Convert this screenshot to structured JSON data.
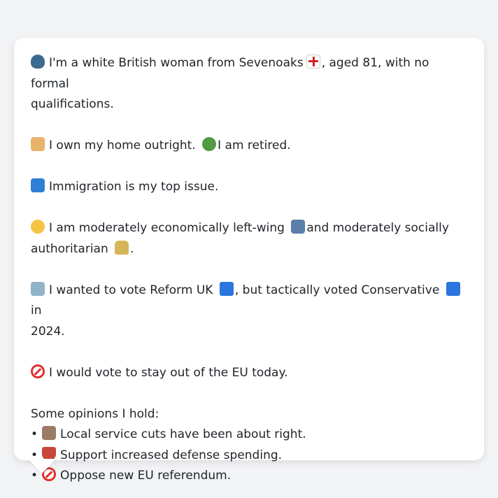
{
  "profile": {
    "intro_a": "I'm a white British woman from Sevenoaks",
    "intro_b": ", aged 81, with no formal",
    "intro_c": "qualifications.",
    "home_a": "I own my home outright.",
    "home_b": "I am retired.",
    "issue": "Immigration is my top issue.",
    "ideology_a": "I am moderately economically left-wing",
    "ideology_b": "and moderately socially",
    "ideology_c": "authoritarian",
    "ideology_d": ".",
    "vote_a": "I wanted to vote Reform UK",
    "vote_b": ", but tactically voted Conservative",
    "vote_c": "in",
    "vote_d": "2024.",
    "eu": "I would vote to stay out of the EU today.",
    "opinions_heading": "Some opinions I hold:",
    "bullet_char": "•",
    "opinions": [
      "Local service cuts have been about right.",
      "Support increased defense spending.",
      "Oppose new EU referendum."
    ]
  },
  "icons": {
    "person": "bust-in-silhouette-icon",
    "flag": "england-flag-icon",
    "house": "house-icon",
    "palm": "palm-tree-icon",
    "passport": "passport-control-icon",
    "think": "thinking-face-icon",
    "arrow": "left-arrow-icon",
    "lock": "lock-icon",
    "ballot": "ballot-box-icon",
    "blue_square": "blue-square-icon",
    "no_entry": "prohibited-icon",
    "derelict": "derelict-house-icon",
    "shield": "shield-icon"
  },
  "colors": {
    "background": "#f2f3f5",
    "card": "#ffffff",
    "text": "#1f2328",
    "party_blue": "#2a76de",
    "prohibited_red": "#e0312e"
  }
}
